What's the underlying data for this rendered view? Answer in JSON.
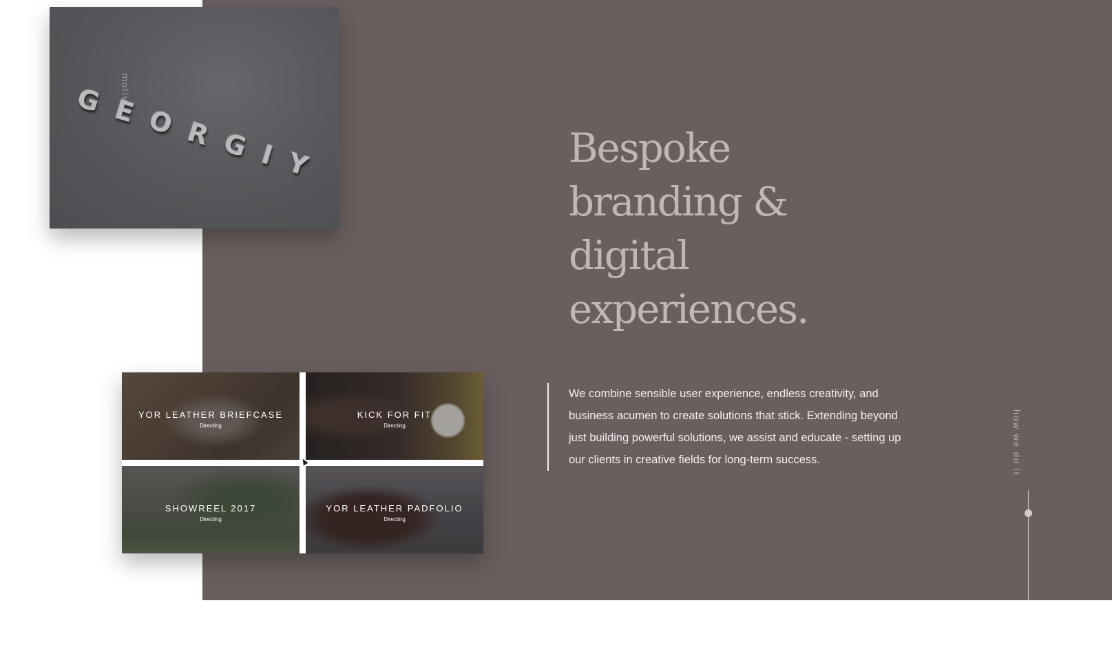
{
  "logo": {
    "small_text": "motiv",
    "big_text": "GEORGIY"
  },
  "hero": {
    "headline": "Bespoke branding & digital experiences.",
    "body": "We combine sensible user experience, endless creativity, and business acumen to create solutions that stick. Extending beyond just building powerful solutions, we assist and educate - setting up our clients in creative fields for long-term success."
  },
  "side_nav": {
    "label": "how we do it"
  },
  "projects": [
    {
      "title": "YOR LEATHER BRIEFCASE",
      "role": "Directing"
    },
    {
      "title": "KICK FOR FIT",
      "role": "Directing"
    },
    {
      "title": "SHOWREEL 2017",
      "role": "Directing"
    },
    {
      "title": "YOR LEATHER PADFOLIO",
      "role": "Directing"
    }
  ],
  "colors": {
    "panel": "#695f5e",
    "headline": "#bfb8b6",
    "body": "#f4f0ef"
  }
}
